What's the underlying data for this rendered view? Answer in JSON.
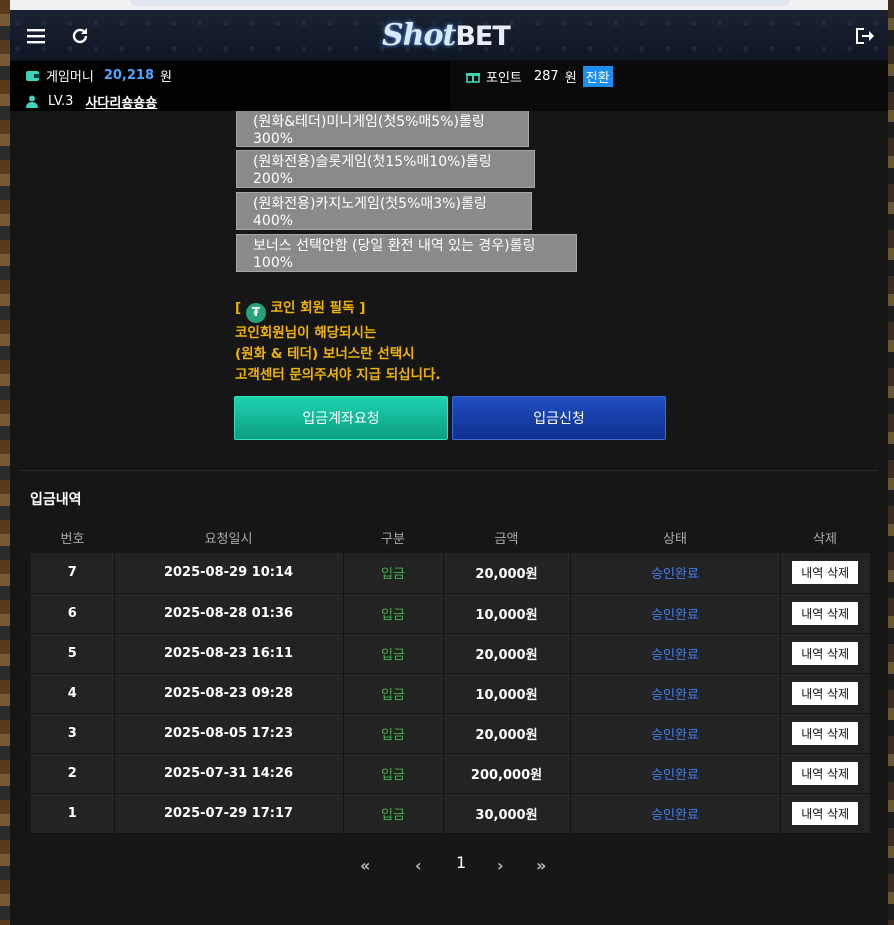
{
  "header": {
    "logo_a": "Shot",
    "logo_b": "BET"
  },
  "info": {
    "game_money_label": "게임머니",
    "game_money_value": "20,218",
    "won": "원",
    "point_label": "포인트",
    "point_value": "287",
    "point_won": "원",
    "convert_label": "전환",
    "level": "LV.3",
    "nickname": "사다리숑숑숑"
  },
  "bonus_options": [
    "(원화&테더)미니게임(첫5%매5%)롤링300%",
    "(원화전용)슬롯게임(첫15%매10%)롤링200%",
    "(원화전용)카지노게임(첫5%매3%)롤링400%",
    "보너스 선택안함 (당일 환전 내역 있는 경우)롤링100%"
  ],
  "notice": {
    "line1_open": "[",
    "line1_text": "코인 회원 필독 ]",
    "line2": "코인회원님이 해당되시는",
    "line3": "(원화 & 테더) 보너스란 선택시",
    "line4": "고객센터 문의주셔야 지급 되십니다."
  },
  "actions": {
    "request_account": "입금계좌요청",
    "apply_deposit": "입금신청"
  },
  "history": {
    "title": "입금내역",
    "columns": [
      "번호",
      "요청일시",
      "구분",
      "금액",
      "상태",
      "삭제"
    ],
    "rows": [
      {
        "no": "7",
        "date": "2025-08-29 10:14",
        "type": "입금",
        "amount": "20,000원",
        "status": "승인완료",
        "del": "내역 삭제"
      },
      {
        "no": "6",
        "date": "2025-08-28 01:36",
        "type": "입금",
        "amount": "10,000원",
        "status": "승인완료",
        "del": "내역 삭제"
      },
      {
        "no": "5",
        "date": "2025-08-23 16:11",
        "type": "입금",
        "amount": "20,000원",
        "status": "승인완료",
        "del": "내역 삭제"
      },
      {
        "no": "4",
        "date": "2025-08-23 09:28",
        "type": "입금",
        "amount": "10,000원",
        "status": "승인완료",
        "del": "내역 삭제"
      },
      {
        "no": "3",
        "date": "2025-08-05 17:23",
        "type": "입금",
        "amount": "20,000원",
        "status": "승인완료",
        "del": "내역 삭제"
      },
      {
        "no": "2",
        "date": "2025-07-31 14:26",
        "type": "입금",
        "amount": "200,000원",
        "status": "승인완료",
        "del": "내역 삭제"
      },
      {
        "no": "1",
        "date": "2025-07-29 17:17",
        "type": "입금",
        "amount": "30,000원",
        "status": "승인완료",
        "del": "내역 삭제"
      }
    ]
  },
  "pagination": {
    "first": "«",
    "prev": "‹",
    "current": "1",
    "next": "›",
    "last": "»"
  }
}
